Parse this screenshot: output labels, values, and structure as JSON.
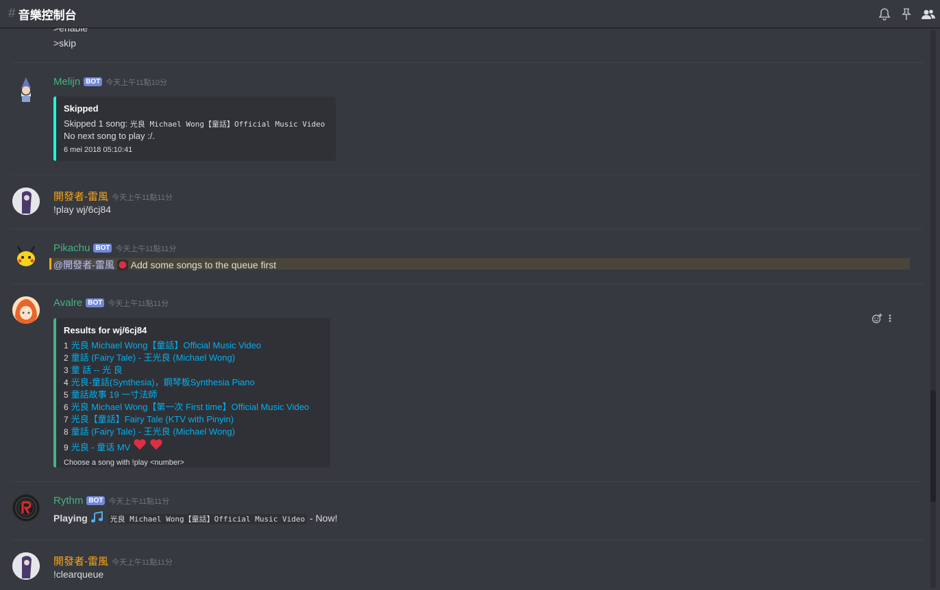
{
  "header": {
    "channel": "音樂控制台"
  },
  "colors": {
    "accent": "#7289da",
    "bot_green": "#43b581",
    "dev_yellow": "#faa61a",
    "melijn_embed": "#1df8d4",
    "avalre_embed": "#43b581"
  },
  "top_commands": [
    ">enable",
    ">skip"
  ],
  "melijn": {
    "name": "Melijn",
    "badge": "BOT",
    "time": "今天上午11點10分",
    "embed_title": "Skipped",
    "embed_prefix": "Skipped 1 song: ",
    "embed_song": "光良 Michael Wong【童話】Official Music Video",
    "embed_line2": "No next song to play :/.",
    "embed_footer": "6 mei 2018 05:10:41"
  },
  "dev1": {
    "name": "開發者-雷風",
    "time": "今天上午11點11分",
    "text": "!play wj/6cj84"
  },
  "pikachu": {
    "name": "Pikachu",
    "badge": "BOT",
    "time": "今天上午11點11分",
    "mention": "@開發者-雷風",
    "text": " Add some songs to the queue first"
  },
  "avalre": {
    "name": "Avalre",
    "badge": "BOT",
    "time": "今天上午11點11分",
    "embed_title": "Results for wj/6cj84",
    "results": [
      {
        "n": "1",
        "title": "光良 Michael Wong【童話】Official Music Video"
      },
      {
        "n": "2",
        "title": "童話 (Fairy Tale) - 王光良 (Michael Wong)"
      },
      {
        "n": "3",
        "title": "童 話 -- 光 良"
      },
      {
        "n": "4",
        "title": "光良-童話(Synthesia)，鋼琴板Synthesia Piano"
      },
      {
        "n": "5",
        "title": "童話故事 19 一寸法師"
      },
      {
        "n": "6",
        "title": "光良 Michael Wong【第一次 First time】Official Music Video"
      },
      {
        "n": "7",
        "title": "光良【童話】Fairy Tale (KTV with Pinyin)"
      },
      {
        "n": "8",
        "title": "童話 (Fairy Tale) - 王光良 (Michael Wong)"
      },
      {
        "n": "9",
        "title": "光良 - 童话 MV "
      }
    ],
    "embed_footer": "Choose a song with !play <number>"
  },
  "rythm": {
    "name": "Rythm",
    "badge": "BOT",
    "time": "今天上午11點11分",
    "playing": "Playing",
    "song": "光良 Michael Wong【童話】Official Music Video",
    "suffix": " - Now!"
  },
  "dev2": {
    "name": "開發者-雷風",
    "time": "今天上午11點11分",
    "text": "!clearqueue"
  }
}
